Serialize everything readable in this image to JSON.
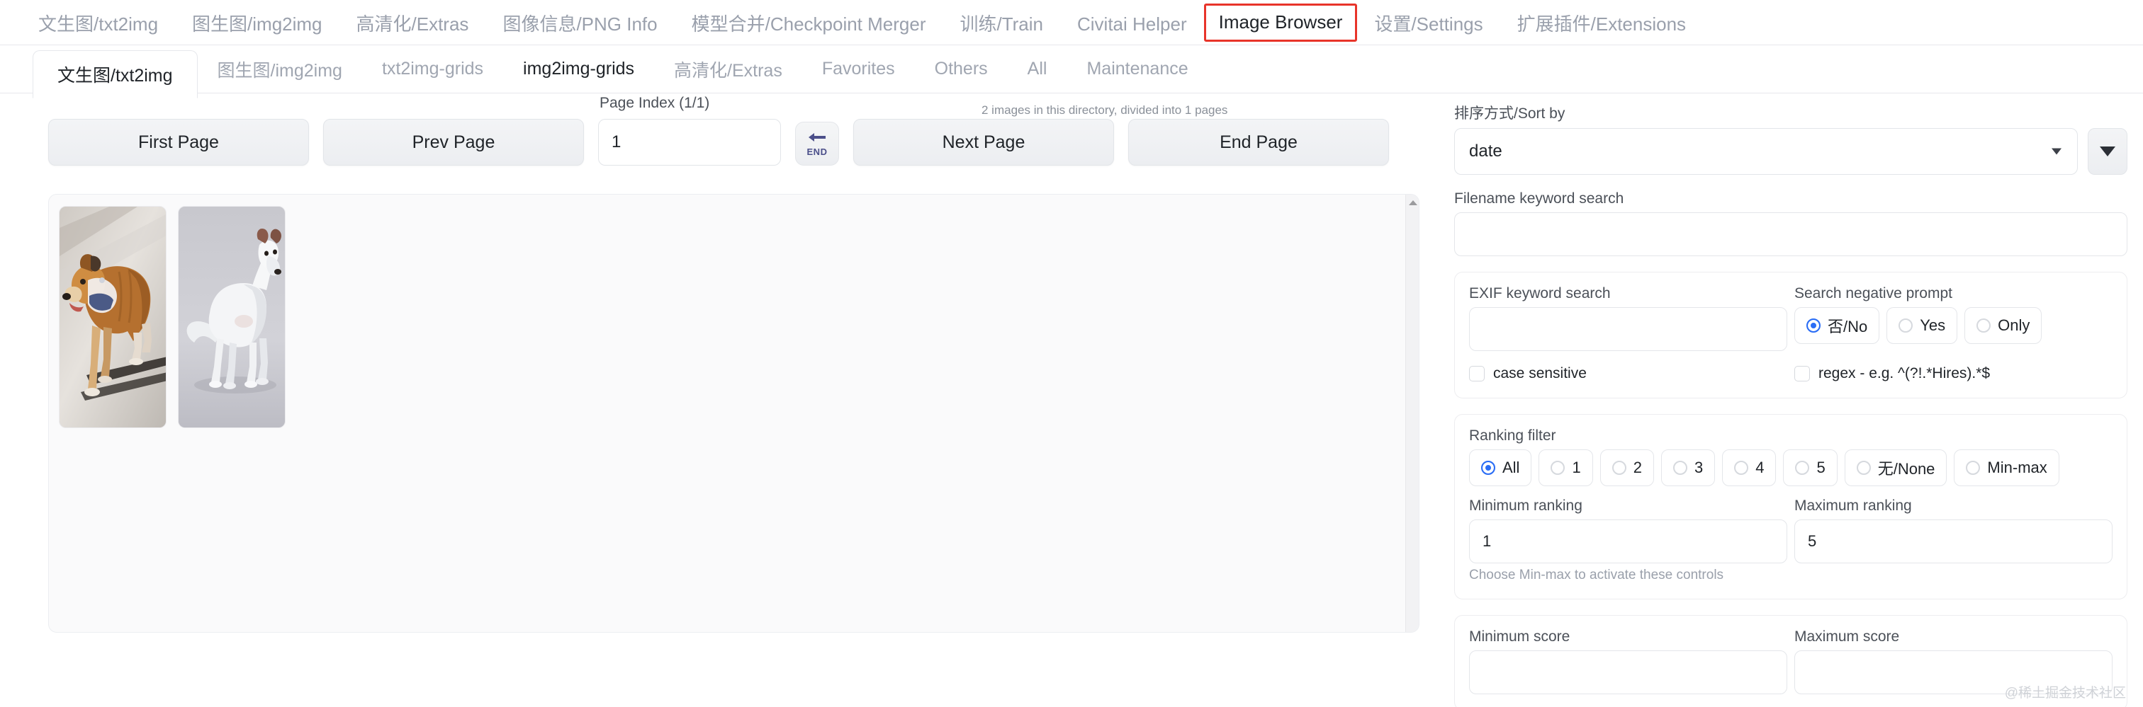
{
  "top_nav": {
    "items": [
      {
        "label": "文生图/txt2img",
        "active": false
      },
      {
        "label": "图生图/img2img",
        "active": false
      },
      {
        "label": "高清化/Extras",
        "active": false
      },
      {
        "label": "图像信息/PNG Info",
        "active": false
      },
      {
        "label": "模型合并/Checkpoint Merger",
        "active": false
      },
      {
        "label": "训练/Train",
        "active": false
      },
      {
        "label": "Civitai Helper",
        "active": false
      },
      {
        "label": "Image Browser",
        "active": true
      },
      {
        "label": "设置/Settings",
        "active": false
      },
      {
        "label": "扩展插件/Extensions",
        "active": false
      }
    ],
    "active_outline_color": "#e8342a"
  },
  "sub_tabs": {
    "items": [
      {
        "label": "文生图/txt2img",
        "state": "selected"
      },
      {
        "label": "图生图/img2img",
        "state": "normal"
      },
      {
        "label": "txt2img-grids",
        "state": "normal"
      },
      {
        "label": "img2img-grids",
        "state": "dark"
      },
      {
        "label": "高清化/Extras",
        "state": "normal"
      },
      {
        "label": "Favorites",
        "state": "normal"
      },
      {
        "label": "Others",
        "state": "normal"
      },
      {
        "label": "All",
        "state": "normal"
      },
      {
        "label": "Maintenance",
        "state": "normal"
      }
    ]
  },
  "pagination": {
    "status_text": "2 images in this directory, divided into 1 pages",
    "first_page_label": "First Page",
    "prev_page_label": "Prev Page",
    "next_page_label": "Next Page",
    "end_page_label": "End Page",
    "page_index_label": "Page Index (1/1)",
    "page_index_value": "1",
    "end_button_label": "END",
    "end_button_icon": "arrow-left-icon",
    "end_button_arrow_color": "#4b4f8a"
  },
  "gallery": {
    "scroll_up_icon": "triangle-up-icon",
    "images": [
      {
        "name": "thumbnail-dog-brown",
        "alt": "brown and white dog with harness standing in sunlight"
      },
      {
        "name": "thumbnail-dog-white",
        "alt": "white dog standing on grey studio backdrop"
      }
    ]
  },
  "sort": {
    "label": "排序方式/Sort by",
    "value": "date",
    "caret_icon": "chevron-down-icon",
    "direction_button_icon": "triangle-down-icon"
  },
  "filename_search": {
    "label": "Filename keyword search",
    "value": "",
    "placeholder": ""
  },
  "exif_panel": {
    "exif_label": "EXIF keyword search",
    "exif_value": "",
    "exif_placeholder": "",
    "negative_prompt_label": "Search negative prompt",
    "negative_prompt_options": [
      {
        "label": "否/No",
        "selected": true
      },
      {
        "label": "Yes",
        "selected": false
      },
      {
        "label": "Only",
        "selected": false
      }
    ],
    "case_sensitive_label": "case sensitive",
    "case_sensitive_checked": false,
    "regex_label": "regex - e.g. ^(?!.*Hires).*$",
    "regex_checked": false,
    "accent_color": "#2a6df5"
  },
  "ranking_panel": {
    "title": "Ranking filter",
    "options": [
      {
        "label": "All",
        "selected": true
      },
      {
        "label": "1",
        "selected": false
      },
      {
        "label": "2",
        "selected": false
      },
      {
        "label": "3",
        "selected": false
      },
      {
        "label": "4",
        "selected": false
      },
      {
        "label": "5",
        "selected": false
      },
      {
        "label": "无/None",
        "selected": false
      },
      {
        "label": "Min-max",
        "selected": false
      }
    ],
    "min_label": "Minimum ranking",
    "min_value": "1",
    "max_label": "Maximum ranking",
    "max_value": "5",
    "hint": "Choose Min-max to activate these controls"
  },
  "score_panel": {
    "min_label": "Minimum score",
    "min_value": "",
    "max_label": "Maximum score",
    "max_value": ""
  },
  "watermark": {
    "text": "@稀土掘金技术社区"
  }
}
